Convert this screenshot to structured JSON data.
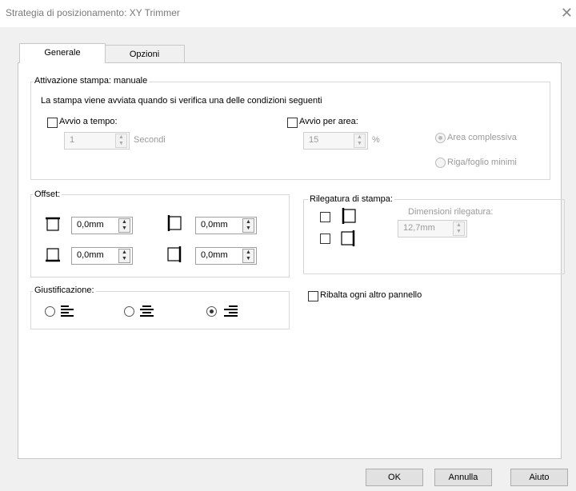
{
  "window": {
    "title": "Strategia di posizionamento: XY Trimmer",
    "close_label": "✕"
  },
  "tabs": [
    {
      "label": "Generale",
      "active": true
    },
    {
      "label": "Opzioni",
      "active": false
    }
  ],
  "activation": {
    "legend": "Attivazione stampa: manuale",
    "description": "La stampa viene avviata quando si verifica una delle condizioni seguenti",
    "time_label": "Avvio a tempo:",
    "time_checked": false,
    "time_value": "1",
    "time_unit": "Secondi",
    "area_label": "Avvio per area:",
    "area_checked": false,
    "area_value": "15",
    "area_unit": "%",
    "radio_total": "Area complessiva",
    "radio_total_selected": true,
    "radio_row": "Riga/foglio minimi",
    "radio_row_selected": false
  },
  "offset": {
    "legend": "Offset:",
    "top": "0,0mm",
    "bottom": "0,0mm",
    "left": "0,0mm",
    "right": "0,0mm"
  },
  "binding": {
    "legend": "Rilegatura di stampa:",
    "size_label": "Dimensioni rilegatura:",
    "size_value": "12,7mm",
    "left_checked": false,
    "top_checked": false
  },
  "justification": {
    "legend": "Giustificazione:",
    "options": [
      "left",
      "center",
      "right"
    ],
    "selected": "right"
  },
  "flip": {
    "label": "Ribalta ogni altro pannello",
    "checked": false
  },
  "buttons": {
    "ok": "OK",
    "cancel": "Annulla",
    "help": "Aiuto"
  },
  "spin_glyphs": {
    "up": "▲",
    "down": "▼"
  }
}
